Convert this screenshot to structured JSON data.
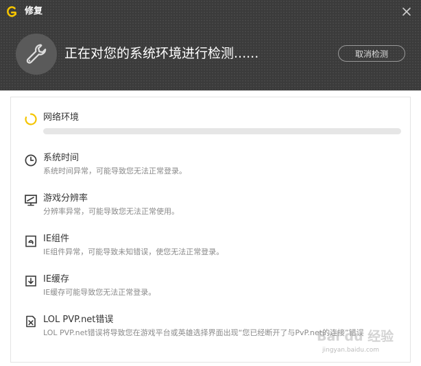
{
  "window": {
    "title": "修复",
    "close_icon": "close-icon",
    "logo_icon": "app-logo-icon"
  },
  "header": {
    "headline": "正在对您的系统环境进行检测......",
    "cancel_label": "取消检测",
    "tool_icon": "wrench-icon"
  },
  "checks": [
    {
      "icon": "loading-spinner-icon",
      "title": "网络环境",
      "progress": 0,
      "status": "checking"
    },
    {
      "icon": "clock-icon",
      "title": "系统时间",
      "desc": "系统时间异常，可能导致您无法正常登录。"
    },
    {
      "icon": "monitor-icon",
      "title": "游戏分辨率",
      "desc": "分辨率异常，可能导致您无法正常使用。"
    },
    {
      "icon": "ie-icon",
      "title": "IE组件",
      "desc": "IE组件异常，可能导致未知错误，使您无法正常登录。"
    },
    {
      "icon": "download-cache-icon",
      "title": "IE缓存",
      "desc": "IE缓存可能导致您无法正常登录。"
    },
    {
      "icon": "file-error-icon",
      "title": "LOL PVP.net错误",
      "desc": "LOL PVP.net错误将导致您在游戏平台或英雄选择界面出现“您已经断开了与PvP.net的连接”错误"
    }
  ],
  "watermark": {
    "text": "Bai du 经验",
    "sub": "jingyan.baidu.com"
  },
  "colors": {
    "accent": "#f4c400",
    "header_bg": "#3b3b3b",
    "text": "#333333",
    "muted": "#8a8a8a"
  }
}
